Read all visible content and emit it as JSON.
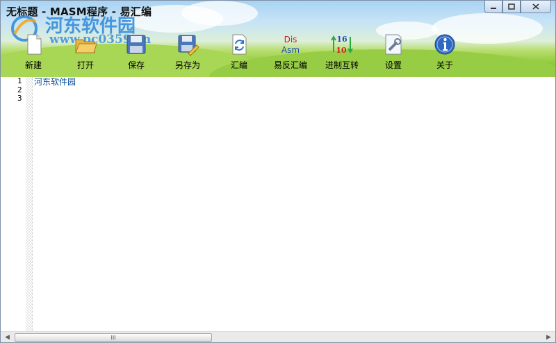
{
  "window": {
    "title": "无标题 - MASM程序 - 易汇编"
  },
  "watermark": {
    "site_name": "河东软件园",
    "url": "www.pc0359.cn"
  },
  "toolbar": {
    "new_label": "新建",
    "open_label": "打开",
    "save_label": "保存",
    "save_as_label": "另存为",
    "assemble_label": "汇编",
    "disassemble_label": "易反汇编",
    "disassemble_icon_top": "Dis",
    "disassemble_icon_bottom": "Asm",
    "base_convert_label": "进制互转",
    "base_convert_icon_top": "16",
    "base_convert_icon_bottom": "10",
    "settings_label": "设置",
    "about_label": "关于"
  },
  "editor": {
    "line_numbers": [
      "1",
      "2",
      "3"
    ],
    "lines": [
      "河东软件园",
      "",
      ""
    ]
  },
  "scrollbar": {
    "grip": "III"
  },
  "colors": {
    "code_text": "#0a4d9a",
    "grass": "#8fca3c",
    "sky": "#a9d3f2"
  }
}
